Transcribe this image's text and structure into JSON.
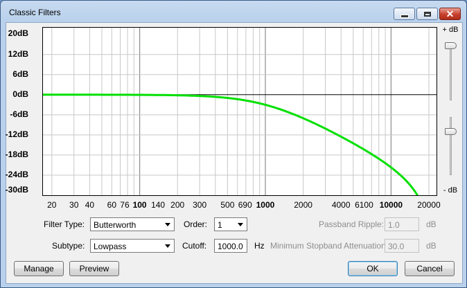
{
  "window": {
    "title": "Classic Filters",
    "minimize_icon": "minimize-icon",
    "maximize_icon": "maximize-icon",
    "close_icon": "close-icon",
    "close_glyph": "✕"
  },
  "graph": {
    "y_labels": [
      "20dB",
      "12dB",
      "6dB",
      "0dB",
      "-6dB",
      "-12dB",
      "-18dB",
      "-24dB",
      "-30dB"
    ],
    "x_labels": [
      {
        "text": "20",
        "bold": false
      },
      {
        "text": "30",
        "bold": false
      },
      {
        "text": "40",
        "bold": false
      },
      {
        "text": "60",
        "bold": false
      },
      {
        "text": "76",
        "bold": false
      },
      {
        "text": "100",
        "bold": true
      },
      {
        "text": "140",
        "bold": false
      },
      {
        "text": "200",
        "bold": false
      },
      {
        "text": "300",
        "bold": false
      },
      {
        "text": "500",
        "bold": false
      },
      {
        "text": "690",
        "bold": false
      },
      {
        "text": "1000",
        "bold": true
      },
      {
        "text": "2000",
        "bold": false
      },
      {
        "text": "4000",
        "bold": false
      },
      {
        "text": "6100",
        "bold": false
      },
      {
        "text": "10000",
        "bold": true
      },
      {
        "text": "20000",
        "bold": false
      }
    ],
    "curve_color": "#00e000",
    "zero_line_color": "#000000"
  },
  "slider": {
    "plus_label": "+ dB",
    "minus_label": "- dB"
  },
  "controls": {
    "filter_type_label": "Filter Type:",
    "filter_type_value": "Butterworth",
    "order_label": "Order:",
    "order_value": "1",
    "passband_ripple_label": "Passband Ripple:",
    "passband_ripple_value": "1.0",
    "passband_unit": "dB",
    "subtype_label": "Subtype:",
    "subtype_value": "Lowpass",
    "cutoff_label": "Cutoff:",
    "cutoff_value": "1000.0",
    "cutoff_unit": "Hz",
    "min_stopband_label": "Minimum Stopband Attenuation:",
    "min_stopband_value": "30.0",
    "stopband_unit": "dB"
  },
  "buttons": {
    "manage": "Manage",
    "preview": "Preview",
    "ok": "OK",
    "cancel": "Cancel"
  }
}
